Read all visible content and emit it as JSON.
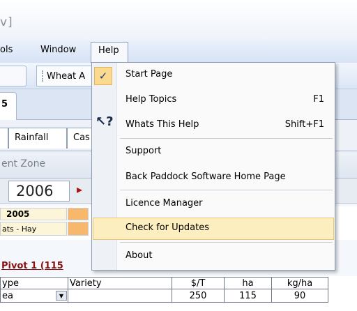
{
  "window": {
    "title": "v]"
  },
  "menubar": {
    "items": [
      "ols",
      "Window",
      "Help"
    ]
  },
  "toolbar": {
    "combo_value": "Wheat A"
  },
  "doc_tab": {
    "label": "5"
  },
  "tabs": [
    "Rainfall",
    "Cas"
  ],
  "zone": {
    "label": "ent Zone"
  },
  "year": {
    "value": "2006",
    "arrow": "▸"
  },
  "grid": {
    "year": "2005",
    "crop": "ats - Hay"
  },
  "paddock": {
    "title": "Pivot 1  (115"
  },
  "table": {
    "headers": [
      "ype",
      "Variety",
      "$/T",
      "ha",
      "kg/ha"
    ],
    "row": {
      "type": "ea",
      "variety": "",
      "price": "250",
      "ha": "115",
      "kgha": "90"
    }
  },
  "help_menu": {
    "start_page": "Start Page",
    "help_topics": "Help Topics",
    "help_topics_key": "F1",
    "whats_this": "Whats This Help",
    "whats_this_key": "Shift+F1",
    "support": "Support",
    "home_page": "Back Paddock Software Home Page",
    "licence": "Licence Manager",
    "updates": "Check for Updates",
    "about": "About"
  },
  "colors": {
    "highlight": "#fdeec0",
    "accent_orange": "#f7b76d",
    "paddock_red": "#8b1010"
  }
}
